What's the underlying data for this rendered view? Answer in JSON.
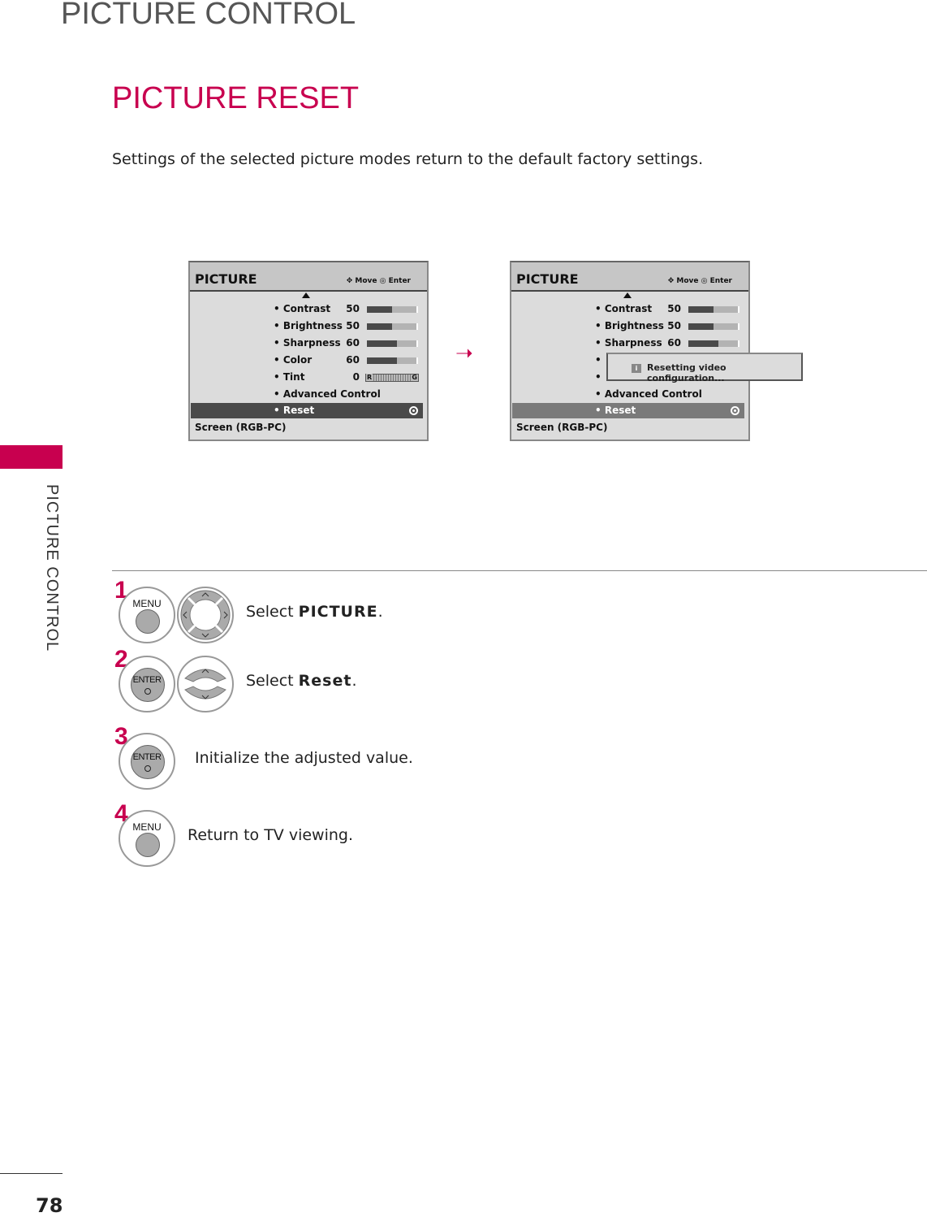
{
  "header": {
    "title": "PICTURE CONTROL",
    "side_label": "PICTURE CONTROL",
    "page_number": "78"
  },
  "section": {
    "title": "PICTURE RESET",
    "intro": "Settings of the selected picture modes return to the default factory settings."
  },
  "colors": {
    "accent": "#c8004f",
    "selected_row_left": "#4a4a4a",
    "selected_row_right": "#7a7a7a"
  },
  "menu": {
    "title": "PICTURE",
    "hint_move": "Move",
    "hint_enter": "Enter",
    "items": [
      {
        "label": "• Contrast",
        "value": "50",
        "level": 50
      },
      {
        "label": "• Brightness",
        "value": "50",
        "level": 50
      },
      {
        "label": "• Sharpness",
        "value": "60",
        "level": 60
      },
      {
        "label": "• Color",
        "value": "60",
        "level": 60
      },
      {
        "label": "• Tint",
        "value": "0",
        "tint": true,
        "left": "R",
        "right": "G"
      },
      {
        "label": "• Advanced Control"
      }
    ],
    "selected": "• Reset",
    "footer": "Screen (RGB-PC)"
  },
  "popup": {
    "message": "Resetting video configuration...",
    "icon": "info-icon",
    "icon_text": "i"
  },
  "steps": [
    {
      "num": "1",
      "text": "Select ",
      "bold": "PICTURE",
      "after": ".",
      "buttons": [
        "MENU",
        "nav-4way"
      ]
    },
    {
      "num": "2",
      "text": "Select ",
      "bold": "Reset",
      "after": ".",
      "buttons": [
        "ENTER",
        "nav-updown"
      ]
    },
    {
      "num": "3",
      "text": "Initialize the adjusted value.",
      "buttons": [
        "ENTER"
      ]
    },
    {
      "num": "4",
      "text": "Return to TV viewing.",
      "buttons": [
        "MENU"
      ]
    }
  ],
  "button_labels": {
    "menu": "MENU",
    "enter": "ENTER"
  }
}
